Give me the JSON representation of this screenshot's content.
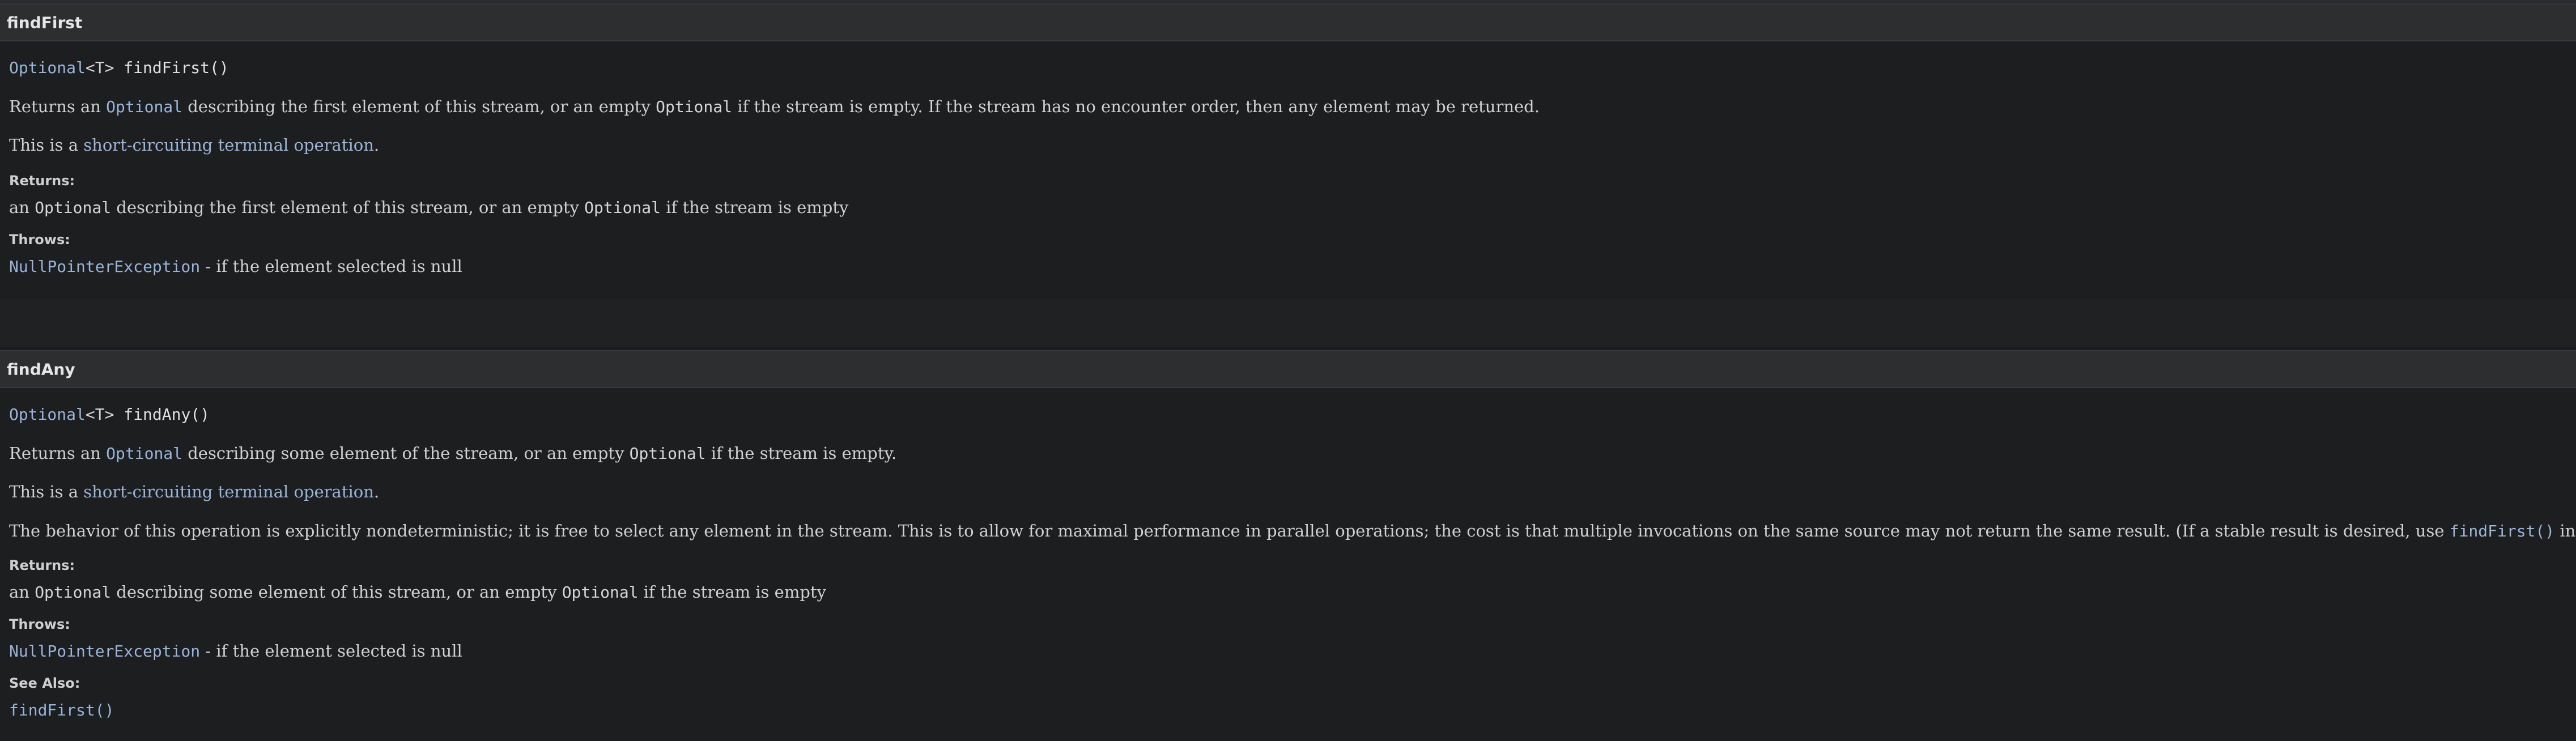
{
  "findFirst": {
    "header": "findFirst",
    "signature": {
      "type_link": "Optional",
      "type_param": "<T>",
      "method": " findFirst()"
    },
    "description": {
      "p1": "Returns an ",
      "link1": "Optional",
      "p2": " describing the first element of this stream, or an empty ",
      "code1": "Optional",
      "p3": " if the stream is empty. If the stream has no encounter order, then any element may be returned."
    },
    "op_note": {
      "prefix": "This is a ",
      "link": "short-circuiting terminal operation",
      "suffix": "."
    },
    "returns_label": "Returns:",
    "returns": {
      "p1": "an ",
      "code1": "Optional",
      "p2": " describing the first element of this stream, or an empty ",
      "code2": "Optional",
      "p3": " if the stream is empty"
    },
    "throws_label": "Throws:",
    "throws": {
      "link": "NullPointerException",
      "text": " - if the element selected is null"
    }
  },
  "findAny": {
    "header": "findAny",
    "signature": {
      "type_link": "Optional",
      "type_param": "<T>",
      "method": " findAny()"
    },
    "description": {
      "p1": "Returns an ",
      "link1": "Optional",
      "p2": " describing some element of the stream, or an empty ",
      "code1": "Optional",
      "p3": " if the stream is empty."
    },
    "op_note": {
      "prefix": "This is a ",
      "link": "short-circuiting terminal operation",
      "suffix": "."
    },
    "behavior": {
      "text": "The behavior of this operation is explicitly nondeterministic; it is free to select any element in the stream. This is to allow for maximal performance in parallel operations; the cost is that multiple invocations on the same source may not return the same result. (If a stable result is desired, use ",
      "link": "findFirst()",
      "suffix": " instead.)"
    },
    "returns_label": "Returns:",
    "returns": {
      "p1": "an ",
      "code1": "Optional",
      "p2": " describing some element of this stream, or an empty ",
      "code2": "Optional",
      "p3": " if the stream is empty"
    },
    "throws_label": "Throws:",
    "throws": {
      "link": "NullPointerException",
      "text": " - if the element selected is null"
    },
    "see_also_label": "See Also:",
    "see_also": {
      "link": "findFirst()"
    }
  }
}
